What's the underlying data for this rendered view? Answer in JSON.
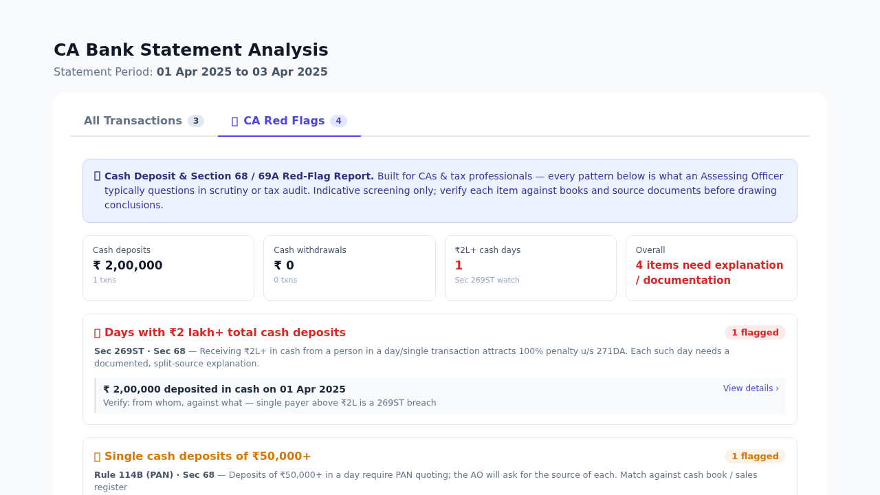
{
  "header": {
    "title": "CA Bank Statement Analysis",
    "period_label": "Statement Period:",
    "period": "01 Apr 2025 to 03 Apr 2025"
  },
  "tabs": [
    {
      "label": "All Transactions",
      "count": "3",
      "icon": false,
      "selected": false
    },
    {
      "label": "CA Red Flags",
      "count": "4",
      "icon": true,
      "selected": true
    }
  ],
  "notice": {
    "text": "**Cash Deposit & Section 68 / 69A Red-Flag Report.** Built for CAs & tax professionals — every pattern below is what an Assessing Officer typically questions in scrutiny or tax audit. Indicative screening only; verify each item against books and source documents before drawing conclusions."
  },
  "stats": [
    {
      "label": "Cash deposits",
      "value": "₹ 2,00,000",
      "note": "1 txns",
      "kind": "plain"
    },
    {
      "label": "Cash withdrawals",
      "value": "₹ 0",
      "note": "0 txns",
      "kind": "plain"
    },
    {
      "label": "₹2L+ cash days",
      "value": "1",
      "note": "Sec 269ST watch",
      "kind": "alert"
    },
    {
      "label": "Overall",
      "value": "4 items need explanation / documentation",
      "kind": "alert"
    }
  ],
  "flags": [
    {
      "title": "Days with ₹2 lakh+ total cash deposits",
      "color": "#dc2626",
      "badge": "1 flagged",
      "description": "**Sec 269ST · Sec 68** — Receiving ₹2L+ in cash from a person in a day/single transaction attracts 100% penalty u/s 271DA. Each such day needs a documented, split-source explanation.",
      "items": [
        {
          "title": "₹ 2,00,000 deposited in cash on 01 Apr 2025",
          "detail": "Verify: from whom, against what — single payer above ₹2L is a 269ST breach",
          "link": "View details ›"
        }
      ]
    },
    {
      "title": "Single cash deposits of ₹50,000+",
      "color": "#d97706",
      "badge": "1 flagged",
      "description": "**Rule 114B (PAN) · Sec 68** — Deposits of ₹50,000+ in a day require PAN quoting; the AO will ask for the source of each. Match against cash book / sales register"
    }
  ]
}
